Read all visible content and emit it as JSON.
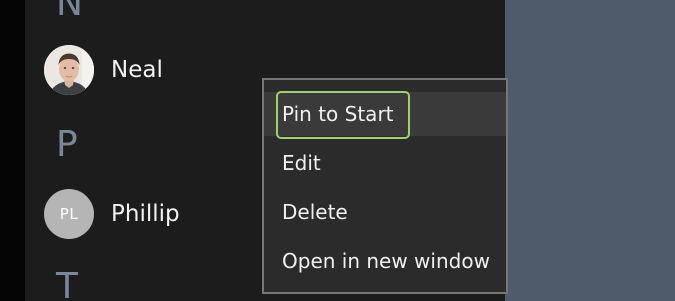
{
  "people": {
    "groups": [
      {
        "letter": "N"
      },
      {
        "letter": "P"
      },
      {
        "letter": "T"
      }
    ],
    "contacts": [
      {
        "name": "Neal",
        "avatar_type": "photo"
      },
      {
        "name": "Phillip",
        "avatar_type": "initials",
        "initials": "PL"
      }
    ]
  },
  "context_menu": {
    "items": [
      {
        "label": "Pin to Start",
        "focused": true
      },
      {
        "label": "Edit"
      },
      {
        "label": "Delete"
      },
      {
        "label": "Open in new window"
      }
    ]
  },
  "colors": {
    "focus_ring": "#9ed071",
    "group_letter": "#7a8799",
    "pane_background": "#1c1c1c",
    "menu_background": "#2b2b2b",
    "right_pane": "#4f5b6a"
  }
}
